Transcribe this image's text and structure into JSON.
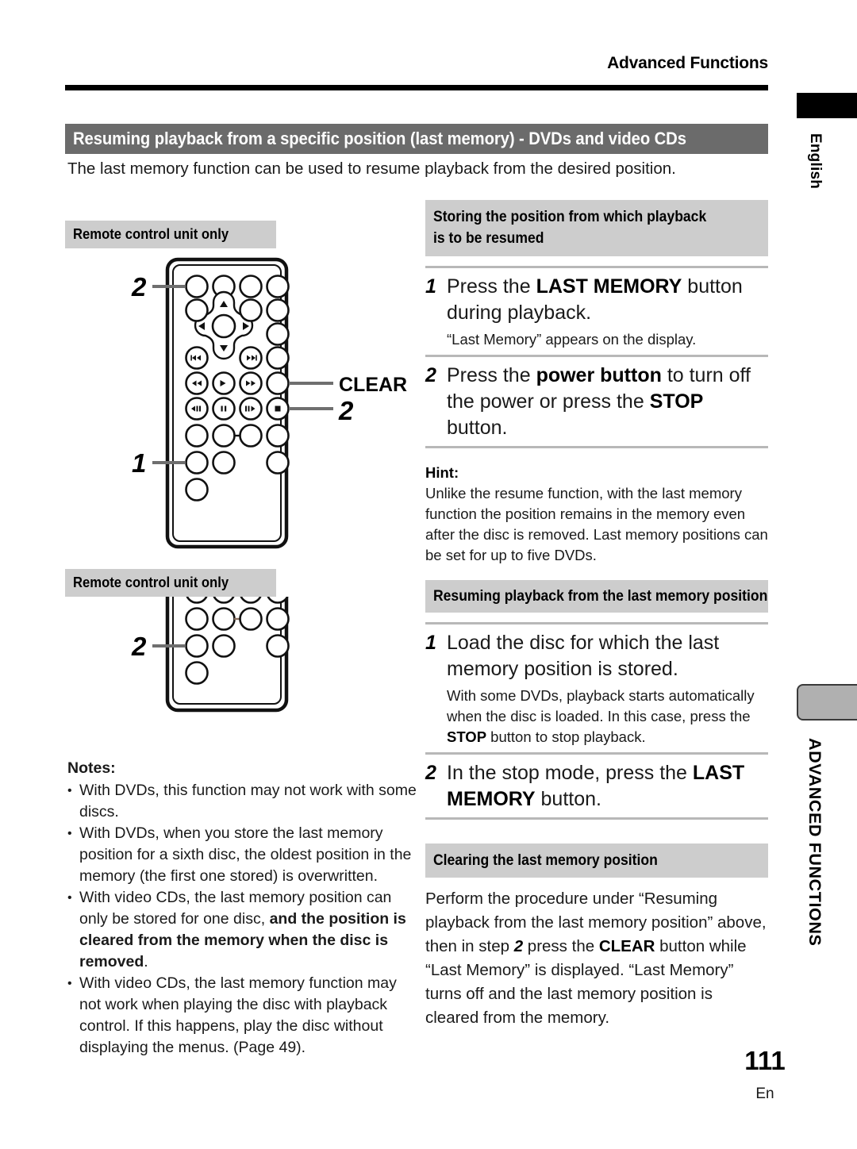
{
  "page": {
    "running_head": "Advanced Functions",
    "number": "111",
    "language_mark": "En"
  },
  "title_band": {
    "text": "Resuming playback from a specific position (last memory) - DVDs and video CDs",
    "bg_color": "#6b6b6b",
    "text_color": "#ffffff"
  },
  "intro": "The last memory function can be used to resume playback from the desired position.",
  "left_column": {
    "remote_label_top": "Remote control unit only",
    "remote_label_bottom": "Remote control unit only",
    "callouts_top": {
      "a": "2",
      "b": "1",
      "c": "2",
      "clear": "CLEAR"
    },
    "callouts_bottom": {
      "a": "2"
    },
    "notes_title": "Notes:",
    "notes": [
      {
        "bullet": "•",
        "parts": [
          {
            "text": "With DVDs, this function may not work with some discs.",
            "bold": false
          }
        ]
      },
      {
        "bullet": "•",
        "parts": [
          {
            "text": "With DVDs, when you store the last memory position for a sixth disc, the oldest position in the memory (the first one stored) is overwritten.",
            "bold": false
          }
        ]
      },
      {
        "bullet": "•",
        "parts": [
          {
            "text": "With video CDs, the last memory position can only be stored for one disc, ",
            "bold": false
          },
          {
            "text": "and the position is cleared from the memory when the disc is removed",
            "bold": true
          },
          {
            "text": ".",
            "bold": false
          }
        ]
      },
      {
        "bullet": "•",
        "parts": [
          {
            "text": "With video CDs, the last memory function may not work when playing the disc with playback control.  If this happens, play the disc without displaying the menus. (Page 49).",
            "bold": false
          }
        ]
      }
    ]
  },
  "right_column": {
    "section1": {
      "heading_line1": "Storing the position from which playback",
      "heading_line2": "is to be resumed",
      "steps": [
        {
          "num": "1",
          "main": [
            {
              "text": "Press the ",
              "bold": false
            },
            {
              "text": "LAST MEMORY",
              "bold": true
            },
            {
              "text": " button during playback.",
              "bold": false
            }
          ],
          "sub": [
            {
              "text": "“Last Memory” appears on the display.",
              "bold": false
            }
          ]
        },
        {
          "num": "2",
          "main": [
            {
              "text": "Press the ",
              "bold": false
            },
            {
              "text": "power button",
              "bold": true
            },
            {
              "text": " to turn off the power or press the ",
              "bold": false
            },
            {
              "text": "STOP",
              "bold": true
            },
            {
              "text": " button.",
              "bold": false
            }
          ],
          "sub": []
        }
      ],
      "hint_title": "Hint:",
      "hint_text": "Unlike the resume function, with the last memory function the position remains in the memory even after the disc is removed.  Last memory positions can be set for up to five DVDs."
    },
    "section2": {
      "heading": "Resuming playback from the last memory position",
      "steps": [
        {
          "num": "1",
          "main": [
            {
              "text": "Load the disc for which the last memory position is stored.",
              "bold": false
            }
          ],
          "sub": [
            {
              "text": "With some DVDs, playback starts automatically when the disc is loaded.  In this case, press the ",
              "bold": false
            },
            {
              "text": "STOP",
              "bold": true
            },
            {
              "text": " button to stop playback.",
              "bold": false
            }
          ]
        },
        {
          "num": "2",
          "main": [
            {
              "text": "In the stop mode, press the ",
              "bold": false
            },
            {
              "text": "LAST MEMORY",
              "bold": true
            },
            {
              "text": " button.",
              "bold": false
            }
          ],
          "sub": []
        }
      ]
    },
    "section3": {
      "heading": "Clearing the last memory position",
      "paragraph": [
        {
          "text": "Perform the procedure under “Resuming playback from the last memory position” above, then in step ",
          "style": "normal"
        },
        {
          "text": "2",
          "style": "bold-italic"
        },
        {
          "text": " press the ",
          "style": "normal"
        },
        {
          "text": "CLEAR",
          "style": "bold"
        },
        {
          "text": " button while “Last Memory” is displayed.  “Last Memory” turns off and the last memory position is cleared from the memory.",
          "style": "normal"
        }
      ]
    }
  },
  "side_tabs": {
    "english": "English",
    "advanced": "ADVANCED FUNCTIONS"
  }
}
